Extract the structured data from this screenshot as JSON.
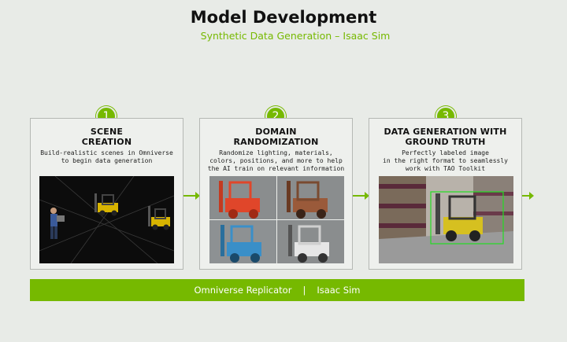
{
  "header": {
    "title": "Model Development",
    "subtitle": "Synthetic Data Generation – Isaac Sim"
  },
  "steps": [
    {
      "number": "1",
      "title_line1": "SCENE",
      "title_line2": "CREATION",
      "desc_lines": [
        "Build-realistic scenes in Omniverse",
        "to begin data generation"
      ],
      "image_icon": "warehouse-scene-icon"
    },
    {
      "number": "2",
      "title_line1": "DOMAIN",
      "title_line2": "RANDOMIZATION",
      "desc_lines": [
        "Randomize lighting, materials,",
        "colors, positions, and more to help",
        "the AI train on relevant information"
      ],
      "image_icon": "randomized-forklifts-icon"
    },
    {
      "number": "3",
      "title_line1": "DATA GENERATION WITH",
      "title_line2": "GROUND TRUTH",
      "desc_lines": [
        "Perfectly labeled image",
        "in the right format to seamlessly",
        "work with TAO Toolkit"
      ],
      "image_icon": "labeled-forklift-icon"
    }
  ],
  "footer": {
    "left": "Omniverse Replicator",
    "separator": "|",
    "right": "Isaac Sim"
  },
  "colors": {
    "accent": "#76b900",
    "background": "#e8ebe7"
  }
}
